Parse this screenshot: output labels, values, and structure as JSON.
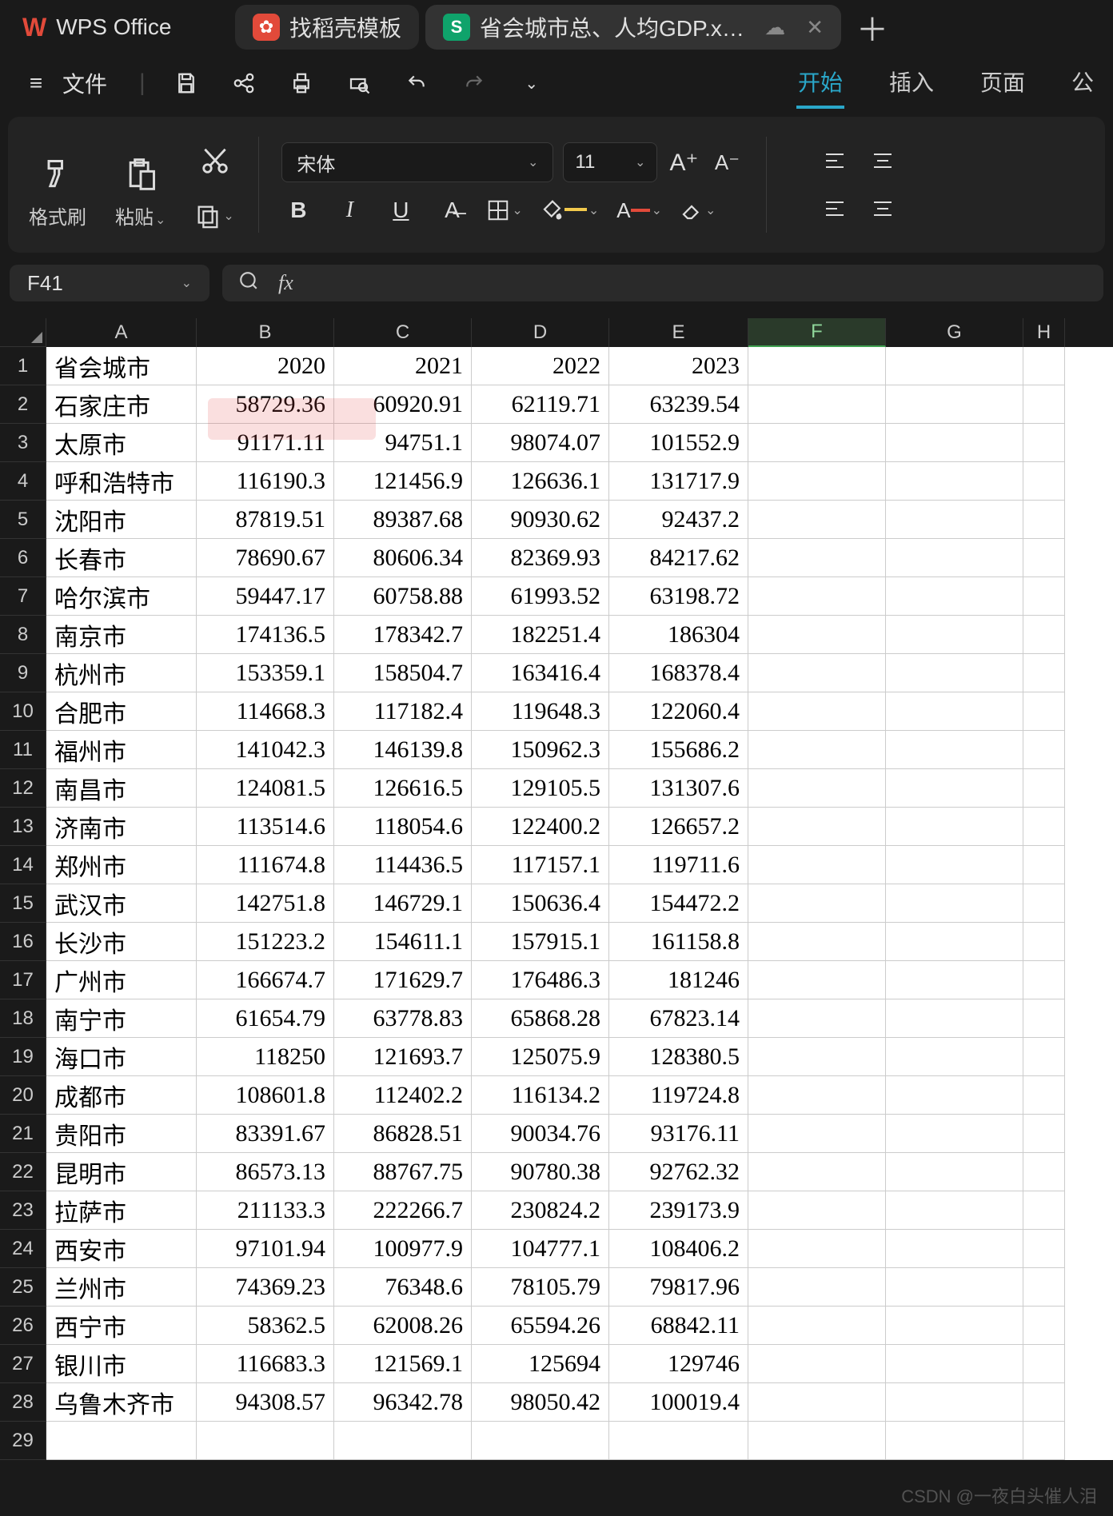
{
  "app": {
    "name": "WPS Office"
  },
  "tabs": [
    {
      "icon": "doc",
      "label": "找稻壳模板",
      "active": false
    },
    {
      "icon": "sheet",
      "label": "省会城市总、人均GDP.xlsx",
      "active": true
    }
  ],
  "menubar": {
    "file": "文件",
    "tabs": [
      "开始",
      "插入",
      "页面",
      "公"
    ],
    "active": "开始"
  },
  "ribbon": {
    "format_painter": "格式刷",
    "paste": "粘贴",
    "font_name": "宋体",
    "font_size": "11"
  },
  "name_box": "F41",
  "columns": [
    "A",
    "B",
    "C",
    "D",
    "E",
    "F",
    "G",
    "H"
  ],
  "selected_col": "F",
  "rows": 29,
  "watermark": "CSDN @一夜白头催人泪",
  "chart_data": {
    "type": "table",
    "title": "省会城市",
    "header": [
      "省会城市",
      "2020",
      "2021",
      "2022",
      "2023"
    ],
    "rows": [
      [
        "石家庄市",
        "58729.36",
        "60920.91",
        "62119.71",
        "63239.54"
      ],
      [
        "太原市",
        "91171.11",
        "94751.1",
        "98074.07",
        "101552.9"
      ],
      [
        "呼和浩特市",
        "116190.3",
        "121456.9",
        "126636.1",
        "131717.9"
      ],
      [
        "沈阳市",
        "87819.51",
        "89387.68",
        "90930.62",
        "92437.2"
      ],
      [
        "长春市",
        "78690.67",
        "80606.34",
        "82369.93",
        "84217.62"
      ],
      [
        "哈尔滨市",
        "59447.17",
        "60758.88",
        "61993.52",
        "63198.72"
      ],
      [
        "南京市",
        "174136.5",
        "178342.7",
        "182251.4",
        "186304"
      ],
      [
        "杭州市",
        "153359.1",
        "158504.7",
        "163416.4",
        "168378.4"
      ],
      [
        "合肥市",
        "114668.3",
        "117182.4",
        "119648.3",
        "122060.4"
      ],
      [
        "福州市",
        "141042.3",
        "146139.8",
        "150962.3",
        "155686.2"
      ],
      [
        "南昌市",
        "124081.5",
        "126616.5",
        "129105.5",
        "131307.6"
      ],
      [
        "济南市",
        "113514.6",
        "118054.6",
        "122400.2",
        "126657.2"
      ],
      [
        "郑州市",
        "111674.8",
        "114436.5",
        "117157.1",
        "119711.6"
      ],
      [
        "武汉市",
        "142751.8",
        "146729.1",
        "150636.4",
        "154472.2"
      ],
      [
        "长沙市",
        "151223.2",
        "154611.1",
        "157915.1",
        "161158.8"
      ],
      [
        "广州市",
        "166674.7",
        "171629.7",
        "176486.3",
        "181246"
      ],
      [
        "南宁市",
        "61654.79",
        "63778.83",
        "65868.28",
        "67823.14"
      ],
      [
        "海口市",
        "118250",
        "121693.7",
        "125075.9",
        "128380.5"
      ],
      [
        "成都市",
        "108601.8",
        "112402.2",
        "116134.2",
        "119724.8"
      ],
      [
        "贵阳市",
        "83391.67",
        "86828.51",
        "90034.76",
        "93176.11"
      ],
      [
        "昆明市",
        "86573.13",
        "88767.75",
        "90780.38",
        "92762.32"
      ],
      [
        "拉萨市",
        "211133.3",
        "222266.7",
        "230824.2",
        "239173.9"
      ],
      [
        "西安市",
        "97101.94",
        "100977.9",
        "104777.1",
        "108406.2"
      ],
      [
        "兰州市",
        "74369.23",
        "76348.6",
        "78105.79",
        "79817.96"
      ],
      [
        "西宁市",
        "58362.5",
        "62008.26",
        "65594.26",
        "68842.11"
      ],
      [
        "银川市",
        "116683.3",
        "121569.1",
        "125694",
        "129746"
      ],
      [
        "乌鲁木齐市",
        "94308.57",
        "96342.78",
        "98050.42",
        "100019.4"
      ]
    ]
  }
}
